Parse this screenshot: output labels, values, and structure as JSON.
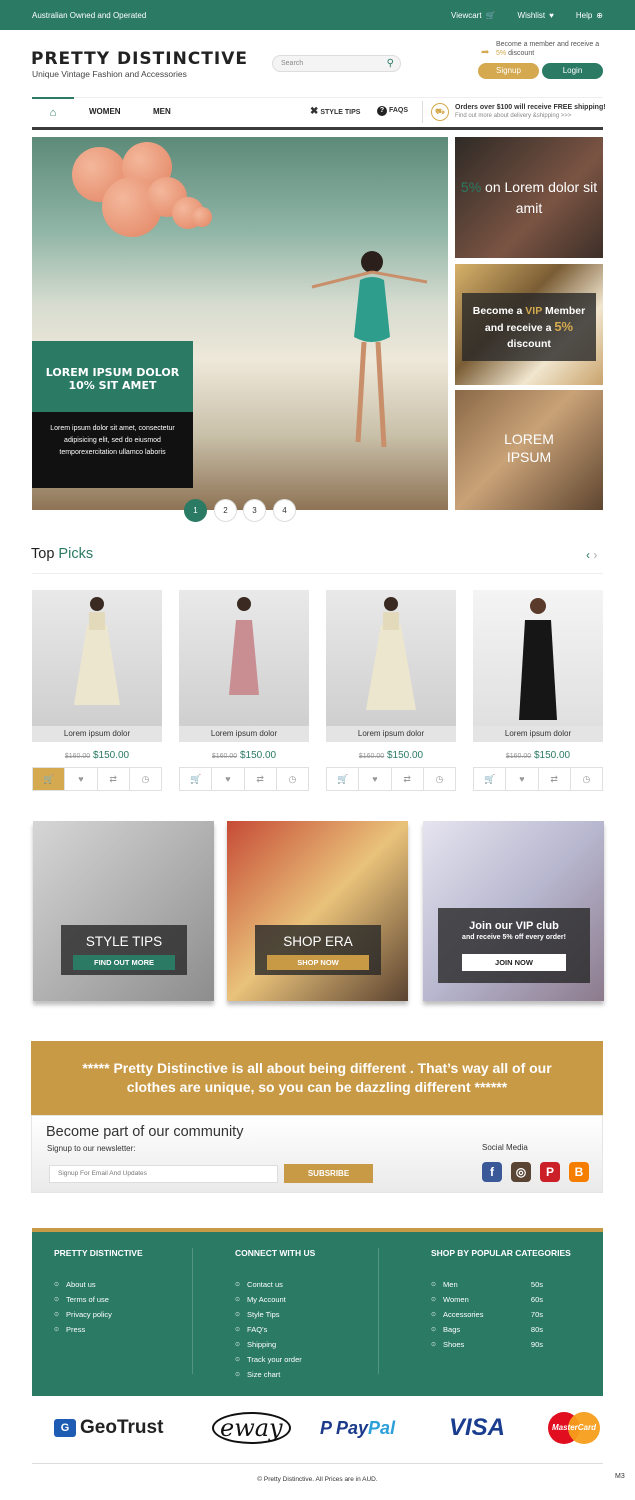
{
  "topbar": {
    "left_text": "Australian Owned and Operated",
    "viewcart": "Viewcart",
    "wishlist": "Wishlist",
    "help": "Help"
  },
  "header": {
    "logo": "PRETTY DISTINCTIVE",
    "tagline": "Unique Vintage Fashion and Accessories",
    "search_placeholder": "Search",
    "member_text": "Become a member and receive a",
    "member_pct": "5%",
    "member_discount": "discount",
    "signup": "Signup",
    "login": "Login"
  },
  "nav": {
    "items": [
      "WOMEN",
      "MEN"
    ],
    "style_tips": "STYLE TIPS",
    "faqs": "FAQS",
    "delivery_title": "Orders over $100 will receive FREE shipping!",
    "delivery_sub": "Find out more about delivery &shipping >>>"
  },
  "hero": {
    "caption": "LOREM IPSUM DOLOR 10% SIT AMET",
    "text": "Lorem ipsum dolor sit amet, consectetur adipisicing elit, sed do eiusmod temporexercitation ullamco laboris",
    "dots": [
      "1",
      "2",
      "3",
      "4"
    ],
    "active_dot": 1
  },
  "side_promos": {
    "promo1_pct": "5%",
    "promo1_text": "on Lorem dolor sit amit",
    "promo2_a": "Become a",
    "promo2_vip": "VIP",
    "promo2_b": "Member and receive a",
    "promo2_pct": "5%",
    "promo2_c": "discount",
    "promo3": "LOREM IPSUM"
  },
  "top_picks": {
    "title_a": "Top",
    "title_b": "Picks",
    "products": [
      {
        "name": "Lorem ipsum dolor",
        "old_price": "$160.00",
        "price": "$150.00"
      },
      {
        "name": "Lorem ipsum dolor",
        "old_price": "$160.00",
        "price": "$150.00"
      },
      {
        "name": "Lorem ipsum dolor",
        "old_price": "$160.00",
        "price": "$150.00"
      },
      {
        "name": "Lorem ipsum dolor",
        "old_price": "$160.00",
        "price": "$150.00"
      }
    ]
  },
  "tiles": {
    "tile1_title": "STYLE TIPS",
    "tile1_btn": "FIND OUT MORE",
    "tile2_title": "SHOP ERA",
    "tile2_btn": "SHOP NOW",
    "tile3_title": "Join our VIP club",
    "tile3_sub": "and receive 5% off every order!",
    "tile3_btn": "JOIN NOW"
  },
  "quote": "***** Pretty Distinctive is all about being different . That’s way all of our clothes are unique, so you can be dazzling different ******",
  "community": {
    "title": "Become part of our community",
    "subtitle": "Signup to our newsletter:",
    "email_placeholder": "Signup For Email And Updates",
    "subscribe": "SUBSRIBE",
    "social_title": "Social Media"
  },
  "footer": {
    "col1_title": "PRETTY DISTINCTIVE",
    "col1_links": [
      "About us",
      "Terms of use",
      "Privacy policy",
      "Press"
    ],
    "col2_title": "CONNECT WITH US",
    "col2_links": [
      "Contact us",
      "My Account",
      "Style Tips",
      "FAQ’s",
      "Shipping",
      "Track your order",
      "Size chart"
    ],
    "col3_title": "SHOP BY POPULAR CATEGORIES",
    "col3_links": [
      {
        "label": "Men",
        "era": "50s"
      },
      {
        "label": "Women",
        "era": "60s"
      },
      {
        "label": "Accessories",
        "era": "70s"
      },
      {
        "label": "Bags",
        "era": "80s"
      },
      {
        "label": "Shoes",
        "era": "90s"
      }
    ]
  },
  "payment_logos": {
    "geotrust": "GeoTrust",
    "eway": "eway",
    "paypal_a": "Pay",
    "paypal_b": "Pal",
    "visa": "VISA",
    "mastercard": "MasterCard"
  },
  "copyright": "© Pretty Distinctive. All Prices are in AUD.",
  "corner_label": "M3",
  "colors": {
    "brand_green": "#2a7a64",
    "gold": "#c99a45",
    "dark": "#222222"
  }
}
